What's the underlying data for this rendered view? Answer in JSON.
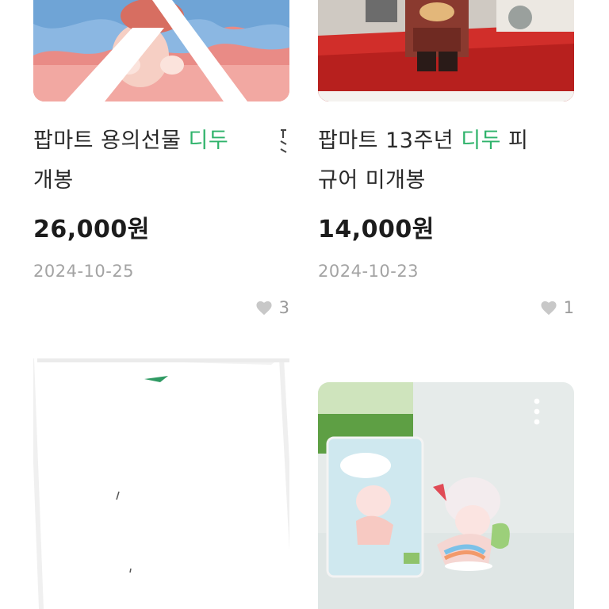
{
  "products": [
    {
      "title_pre": "팝마트 용의선물 ",
      "title_hl": "디두",
      "title_post": "",
      "title_line2": "개봉",
      "price": "26,000원",
      "date": "2024-10-25",
      "likes": "3",
      "icon": "heart-icon"
    },
    {
      "title_pre": "팝마트 13주년 ",
      "title_hl": "디두",
      "title_post": " 피",
      "title_line2": "규어 미개봉",
      "price": "14,000원",
      "date": "2024-10-23",
      "likes": "1",
      "icon": "heart-icon"
    }
  ],
  "colors": {
    "highlight": "#2fb36b",
    "muted": "#a3a3a3",
    "heart": "#c8c8c8"
  },
  "icons": [
    "heart-icon",
    "more-vertical-icon"
  ]
}
